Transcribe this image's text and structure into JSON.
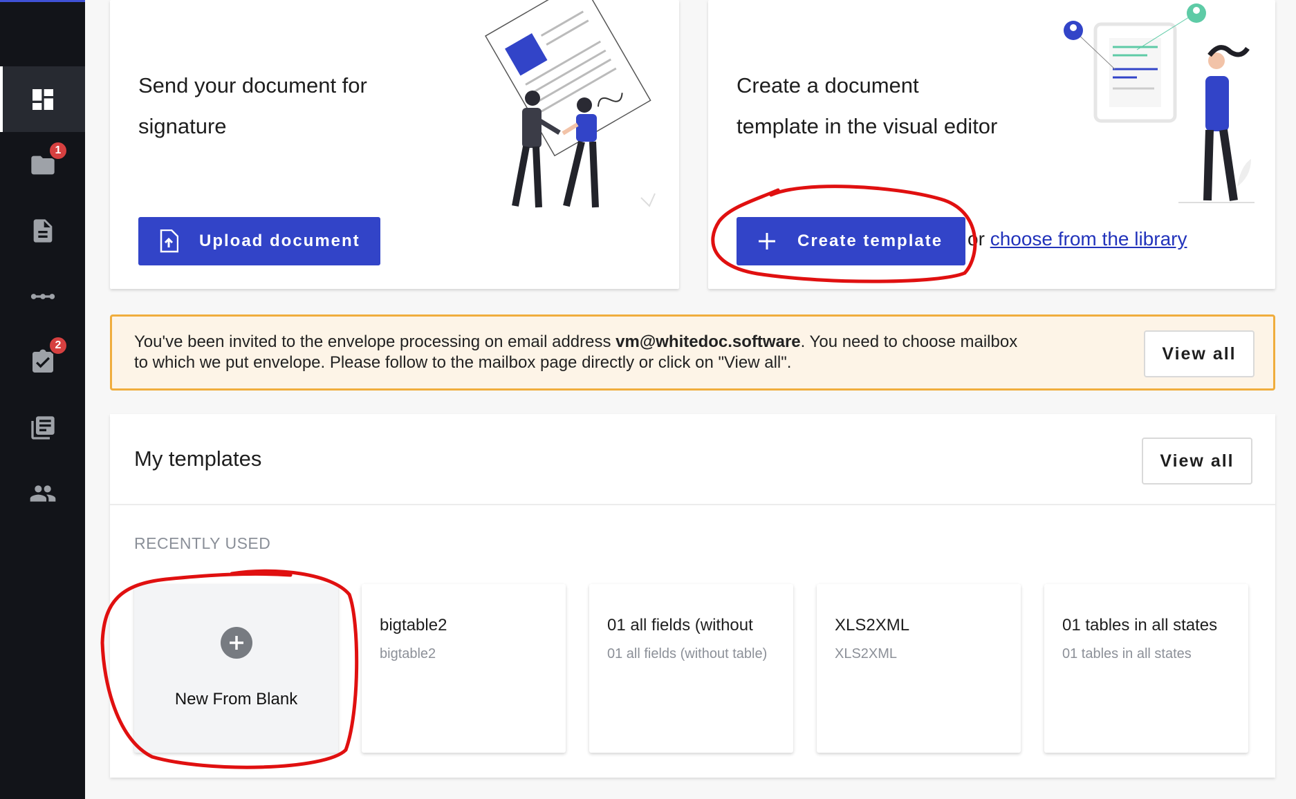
{
  "sidebar": {
    "items": [
      {
        "icon": "dashboard-icon",
        "badge": ""
      },
      {
        "icon": "folder-icon",
        "badge": "1"
      },
      {
        "icon": "document-icon",
        "badge": ""
      },
      {
        "icon": "workflow-icon",
        "badge": ""
      },
      {
        "icon": "task-check-icon",
        "badge": "2"
      },
      {
        "icon": "library-icon",
        "badge": ""
      },
      {
        "icon": "people-icon",
        "badge": ""
      }
    ]
  },
  "send_card": {
    "title_line1": "Send your document for",
    "title_line2": "signature",
    "button_label": "Upload document"
  },
  "template_card": {
    "title_line1": "Create a document",
    "title_line2": "template in the visual editor",
    "button_label": "Create template",
    "or_text": "or ",
    "library_link": "choose from the library"
  },
  "invite_banner": {
    "text_before": "You've been invited to the envelope processing on email address ",
    "email": "vm@whitedoc.software",
    "text_after": ". You need to choose mailbox to which we put envelope. Please follow to the mailbox page directly or click on \"View all\".",
    "button_label": "View all"
  },
  "templates": {
    "title": "My templates",
    "view_all_label": "View all",
    "recently_label": "RECENTLY USED",
    "new_blank_label": "New From Blank",
    "items": [
      {
        "name": "bigtable2",
        "subtitle": "bigtable2"
      },
      {
        "name": "01 all fields (without",
        "subtitle": "01 all fields (without table)"
      },
      {
        "name": "XLS2XML",
        "subtitle": "XLS2XML"
      },
      {
        "name": "01 tables in all states",
        "subtitle": "01 tables in all states"
      }
    ]
  },
  "colors": {
    "primary": "#3244c8",
    "sidebar_bg": "#121419",
    "banner_border": "#f0ad3d",
    "banner_bg": "#fdf4e7",
    "annotation": "#e01010"
  }
}
